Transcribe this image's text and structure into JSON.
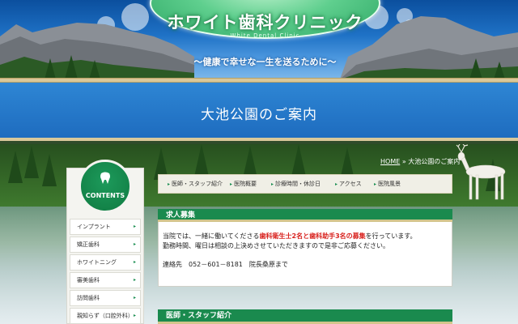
{
  "header": {
    "logo_title": "ホワイト歯科クリニック",
    "logo_subtitle": "White Dental Clinic",
    "tagline": "～健康で幸せな一生を送るために～"
  },
  "page_title": "大池公園のご案内",
  "breadcrumb": {
    "home": "HOME",
    "separator": "»",
    "current": "大池公園のご案内"
  },
  "sidebar": {
    "heading": "CONTENTS",
    "items": [
      {
        "label": "インプラント"
      },
      {
        "label": "矯正歯科"
      },
      {
        "label": "ホワイトニング"
      },
      {
        "label": "審美歯科"
      },
      {
        "label": "訪問歯科"
      },
      {
        "label": "親知らず（口腔外科）"
      }
    ],
    "arrow": "▸"
  },
  "nav": {
    "arrow": "▸",
    "items": [
      {
        "label": "医師・スタッフ紹介"
      },
      {
        "label": "医院概要"
      },
      {
        "label": "診療時間・休診日"
      },
      {
        "label": "アクセス"
      },
      {
        "label": "医院風景"
      }
    ]
  },
  "recruit": {
    "heading": "求人募集",
    "line1_a": "当院では、一緒に働いてくださる",
    "line1_red": "歯科衛生士2名と歯科助手3名の募集",
    "line1_b": "を行っています。",
    "line2": "勤務時間、曜日は相談の上決めさせていただきますので是非ご応募ください。",
    "contact": "連絡先　052－601－8181　院長桑原まで"
  },
  "staff": {
    "heading": "医師・スタッフ紹介"
  },
  "colors": {
    "accent_green": "#1a8a4e",
    "header_blue": "#1f72c6",
    "highlight_red": "#d8211d"
  }
}
